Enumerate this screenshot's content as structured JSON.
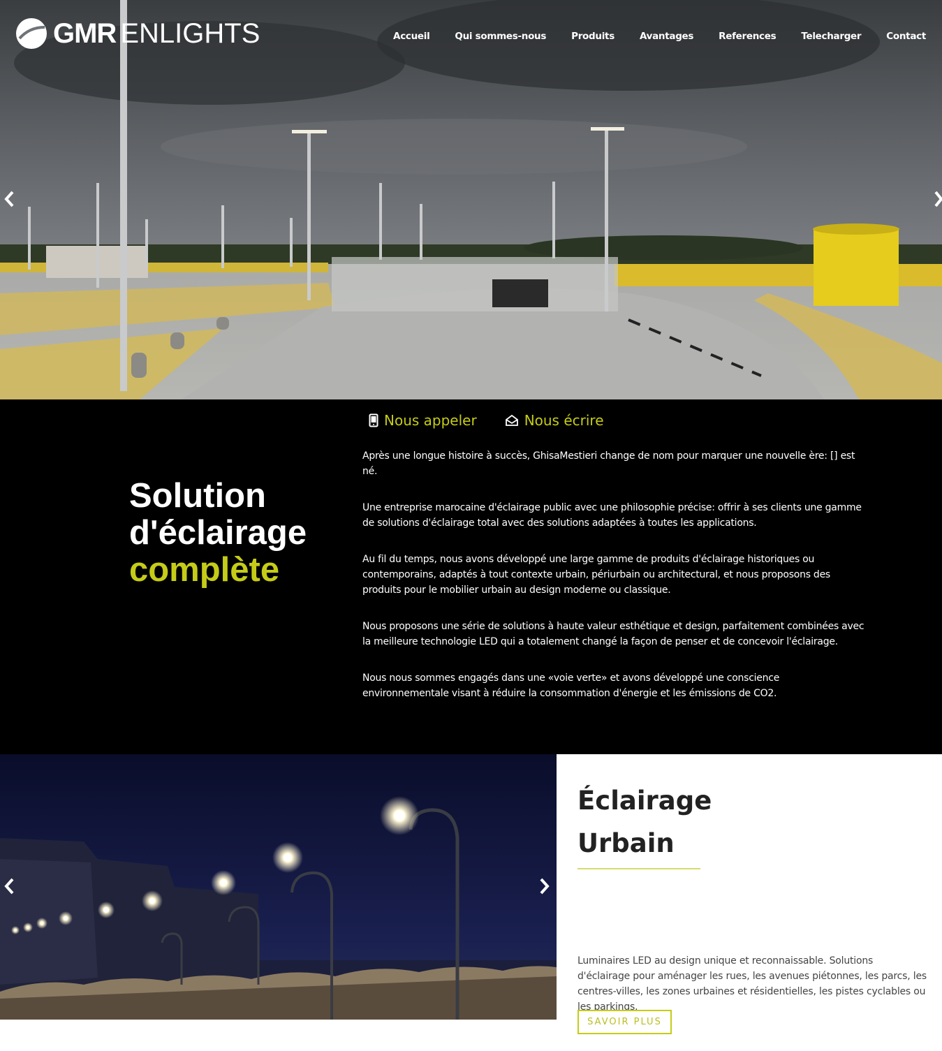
{
  "brand": {
    "bold": "GMR",
    "light": "ENLIGHTS"
  },
  "nav": [
    {
      "label": "Accueil"
    },
    {
      "label": "Qui sommes-nous"
    },
    {
      "label": "Produits"
    },
    {
      "label": "Avantages"
    },
    {
      "label": "References"
    },
    {
      "label": "Telecharger"
    },
    {
      "label": "Contact"
    }
  ],
  "hero": {
    "prev_icon": "chevron-left-icon",
    "next_icon": "chevron-right-icon"
  },
  "contact": {
    "call_label": "Nous appeler",
    "write_label": "Nous écrire",
    "call_icon": "phone-icon",
    "write_icon": "envelope-open-icon"
  },
  "about": {
    "headline_line1": "Solution",
    "headline_line2": "d'éclairage",
    "headline_accent": "complète",
    "paragraphs": [
      "Après une longue histoire à succès, GhisaMestieri change de nom pour marquer une nouvelle ère: [] est né.",
      "Une entreprise marocaine d'éclairage public avec une philosophie précise: offrir à ses clients une gamme de solutions d'éclairage total avec des solutions adaptées à toutes les applications.",
      "Au fil du temps, nous avons développé une large gamme de produits d'éclairage historiques ou contemporains, adaptés à tout contexte urbain, périurbain ou architectural, et nous proposons des produits pour le mobilier urbain au design moderne ou classique.",
      "Nous proposons une série de solutions à haute valeur esthétique et design, parfaitement combinées avec la meilleure technologie LED qui a totalement changé la façon de penser et de concevoir l'éclairage.",
      "Nous nous sommes engagés dans une «voie verte» et avons développé une conscience environnementale visant à réduire la consommation d'énergie et les émissions de CO2."
    ]
  },
  "urban": {
    "title_line1": "Éclairage",
    "title_line2": "Urbain",
    "description": "Luminaires LED au design unique et reconnaissable. Solutions d'éclairage pour aménager les rues, les avenues piétonnes, les parcs, les centres-villes, les zones urbaines et résidentielles, les pistes cyclables ou les parkings.",
    "button_label": "SAVOIR PLUS"
  },
  "colors": {
    "accent": "#c5cc17",
    "dark": "#000000",
    "text": "#ffffff"
  }
}
